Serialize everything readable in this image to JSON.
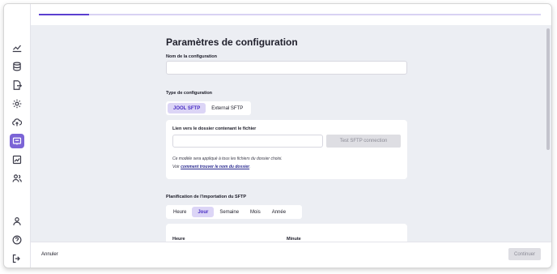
{
  "header": {
    "progress": 0.1
  },
  "sidebar": {
    "icons": [
      "chart-icon",
      "database-icon",
      "file-export-icon",
      "gear-icon",
      "cloud-upload-icon",
      "sftp-config-icon",
      "analytics-icon",
      "users-icon",
      "user-icon",
      "help-icon",
      "logout-icon"
    ],
    "active": "sftp-config-icon"
  },
  "main": {
    "title": "Paramètres de configuration",
    "name_label": "Nom de la configuration",
    "name_value": "",
    "type_label": "Type de configuration",
    "type_options": [
      "JOOL SFTP",
      "External SFTP"
    ],
    "type_selected": "JOOL SFTP",
    "folder_label": "Lien vers le dossier contenant le fichier",
    "folder_value": "",
    "test_button": "Test SFTP connection",
    "hint_line1": "Ce modèle sera appliqué à tous les fichiers du dossier choisi.",
    "hint_line2_prefix": "Voir ",
    "hint_link": "comment trouver le nom du dossier",
    "hint_line2_suffix": ".",
    "schedule_label": "Planification de l'importation du SFTP",
    "schedule_options": [
      "Heure",
      "Jour",
      "Semaine",
      "Mois",
      "Année"
    ],
    "schedule_selected": "Jour",
    "hour_label": "Heure",
    "minute_label": "Minute"
  },
  "footer": {
    "cancel": "Annuler",
    "continue": "Continuer"
  },
  "colors": {
    "accent": "#5b3fd0",
    "active_bg": "#dcd5f6",
    "sidebar_active": "#7b64d6"
  }
}
